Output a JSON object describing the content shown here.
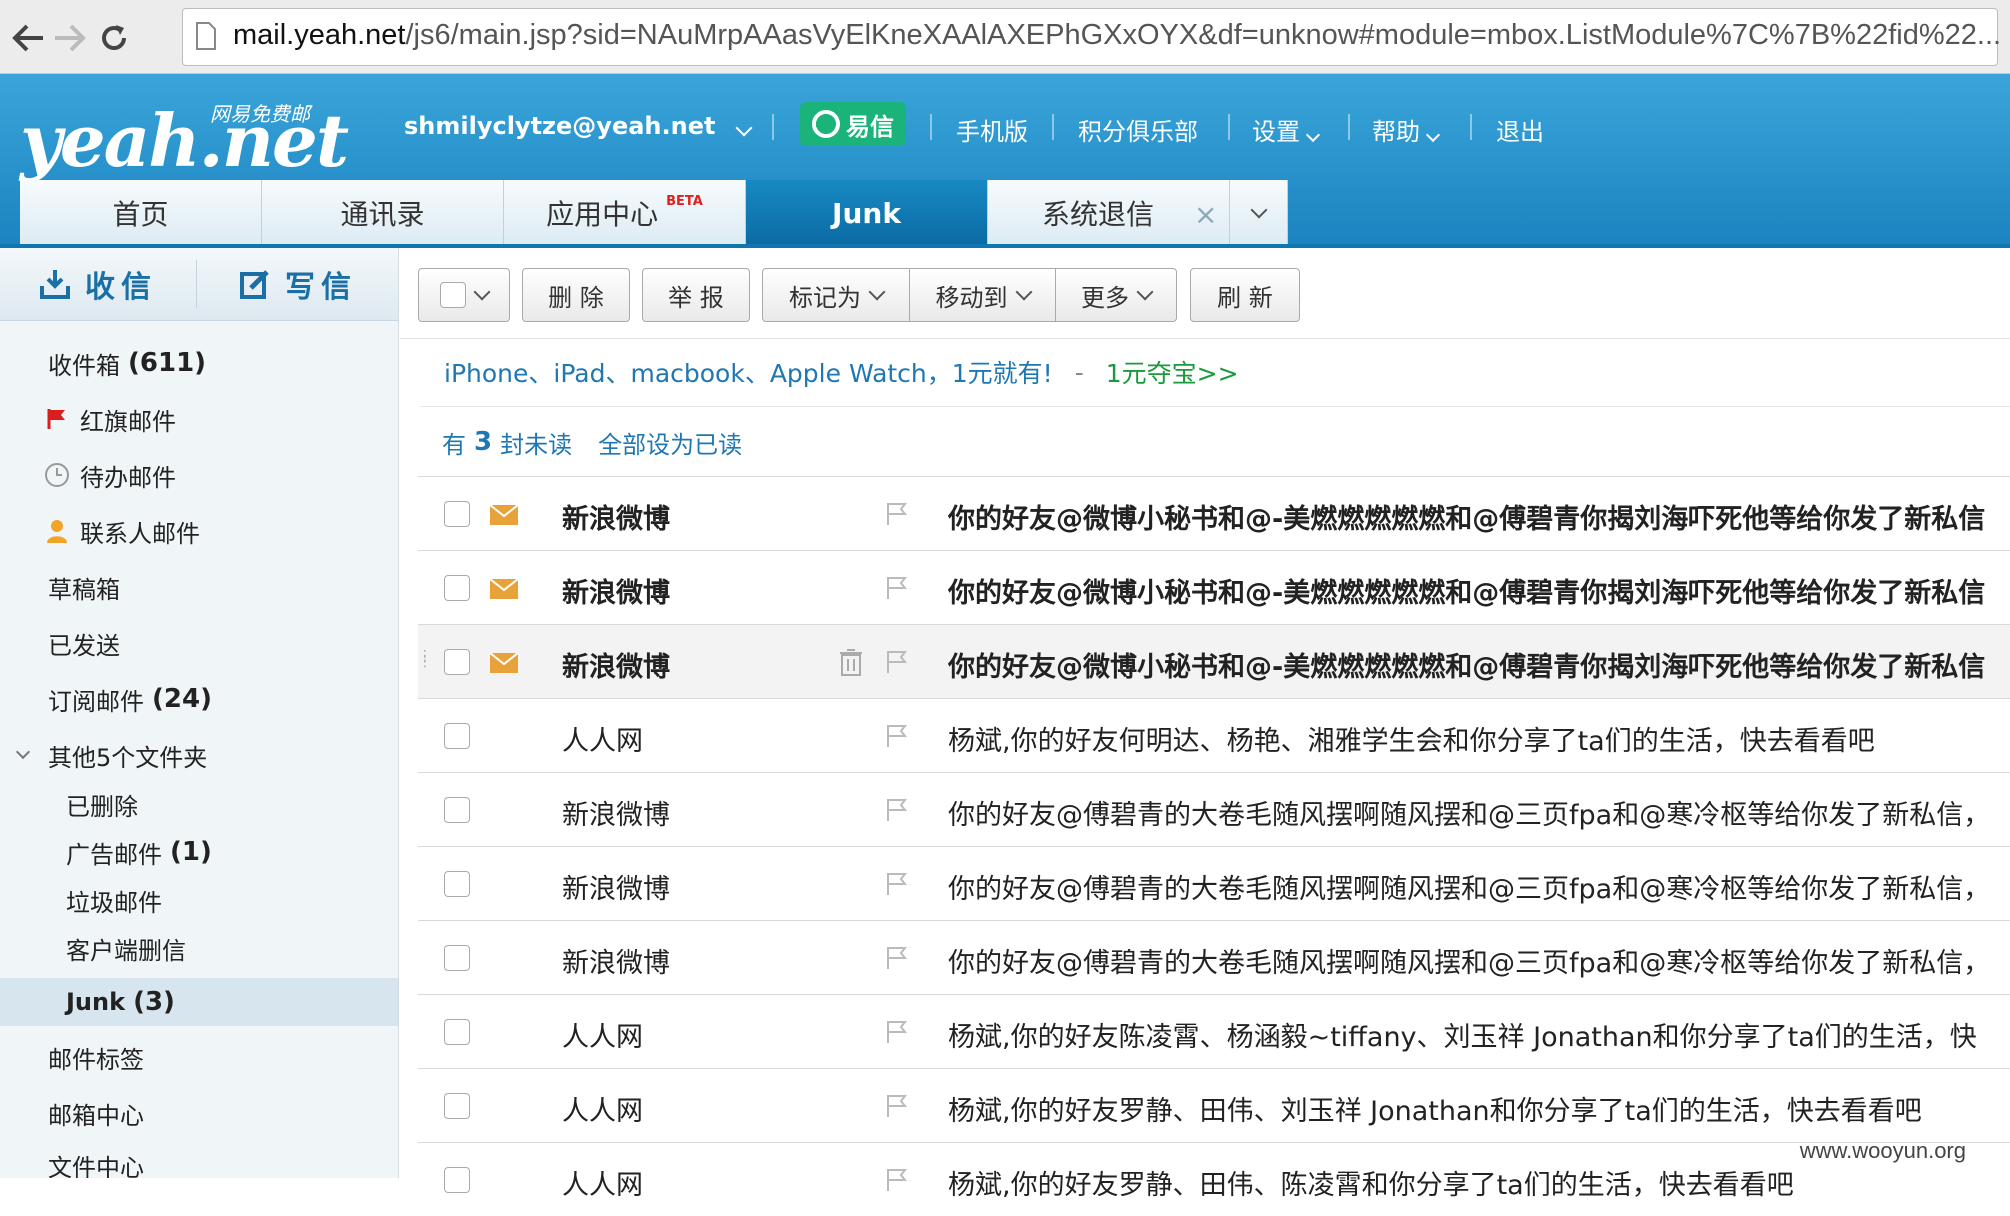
{
  "browser": {
    "url_host": "mail.yeah.net",
    "url_path": "/js6/main.jsp?sid=NAuMrpAAasVyElKneXAAlAXEPhGXxOYX&df=unknow#module=mbox.ListModule%7C%7B%22fid%22..."
  },
  "header": {
    "logo_text": "yeah.net",
    "logo_tagline": "网易免费邮",
    "account": "shmilyclytze@yeah.net",
    "yixin": "易信",
    "nav": [
      "手机版",
      "积分俱乐部",
      "设置",
      "帮助",
      "退出"
    ]
  },
  "tabs": [
    {
      "label": "首页"
    },
    {
      "label": "通讯录"
    },
    {
      "label": "应用中心",
      "badge": "BETA"
    },
    {
      "label": "Junk"
    },
    {
      "label": "系统退信"
    }
  ],
  "sidebar": {
    "receive": "收信",
    "compose": "写信",
    "folders": [
      {
        "label": "收件箱",
        "count": "(611)"
      },
      {
        "label": "红旗邮件",
        "count": ""
      },
      {
        "label": "待办邮件",
        "count": ""
      },
      {
        "label": "联系人邮件",
        "count": ""
      },
      {
        "label": "草稿箱",
        "count": ""
      },
      {
        "label": "已发送",
        "count": ""
      },
      {
        "label": "订阅邮件",
        "count": "(24)"
      },
      {
        "label": "其他5个文件夹",
        "count": ""
      },
      {
        "label": "已删除",
        "count": ""
      },
      {
        "label": "广告邮件",
        "count": "(1)"
      },
      {
        "label": "垃圾邮件",
        "count": ""
      },
      {
        "label": "客户端删信",
        "count": ""
      },
      {
        "label": "Junk",
        "count": "(3)"
      },
      {
        "label": "邮件标签",
        "count": ""
      },
      {
        "label": "邮箱中心",
        "count": ""
      },
      {
        "label": "文件中心",
        "count": ""
      }
    ]
  },
  "toolbar": {
    "delete": "删 除",
    "report": "举 报",
    "mark_as": "标记为",
    "move_to": "移动到",
    "more": "更多",
    "refresh": "刷 新"
  },
  "ad": {
    "text": "iPhone、iPad、macbook、Apple Watch，1元就有!",
    "dash": "-",
    "link": "1元夺宝>>"
  },
  "unread": {
    "prefix": "有",
    "count": "3",
    "suffix": "封未读",
    "mark_all": "全部设为已读"
  },
  "emails": [
    {
      "sender": "新浪微博",
      "subject": "你的好友@微博小秘书和@-美燃燃燃燃燃和@傅碧青你揭刘海吓死他等给你发了新私信"
    },
    {
      "sender": "新浪微博",
      "subject": "你的好友@微博小秘书和@-美燃燃燃燃燃和@傅碧青你揭刘海吓死他等给你发了新私信"
    },
    {
      "sender": "新浪微博",
      "subject": "你的好友@微博小秘书和@-美燃燃燃燃燃和@傅碧青你揭刘海吓死他等给你发了新私信"
    },
    {
      "sender": "人人网",
      "subject": "杨斌,你的好友何明达、杨艳、湘雅学生会和你分享了ta们的生活，快去看看吧"
    },
    {
      "sender": "新浪微博",
      "subject": "你的好友@傅碧青的大卷毛随风摆啊随风摆和@三页fpa和@寒冷枢等给你发了新私信，"
    },
    {
      "sender": "新浪微博",
      "subject": "你的好友@傅碧青的大卷毛随风摆啊随风摆和@三页fpa和@寒冷枢等给你发了新私信，"
    },
    {
      "sender": "新浪微博",
      "subject": "你的好友@傅碧青的大卷毛随风摆啊随风摆和@三页fpa和@寒冷枢等给你发了新私信，"
    },
    {
      "sender": "人人网",
      "subject": "杨斌,你的好友陈凌霄、杨涵毅~tiffany、刘玉祥 Jonathan和你分享了ta们的生活，快"
    },
    {
      "sender": "人人网",
      "subject": "杨斌,你的好友罗静、田伟、刘玉祥 Jonathan和你分享了ta们的生活，快去看看吧"
    },
    {
      "sender": "人人网",
      "subject": "杨斌,你的好友罗静、田伟、陈凌霄和你分享了ta们的生活，快去看看吧"
    }
  ],
  "watermark": "www.wooyun.org",
  "colors": {
    "header": "#2a95d0",
    "active_tab": "#1077b0",
    "unread_icon": "#e8a23a",
    "link": "#1f77b4"
  }
}
